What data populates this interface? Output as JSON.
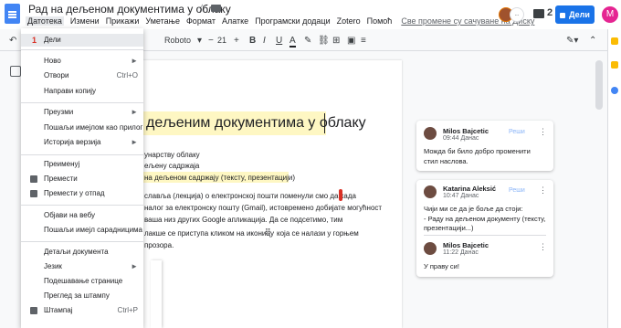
{
  "doc": {
    "title": "Рад на дељеном документима у облаку",
    "save_status": "Све промене су сачуване на Диску",
    "share_label": "Дели",
    "profile_initial": "M",
    "comment_count": "2",
    "extra_avatar_text": "..."
  },
  "menubar": [
    "Датотека",
    "Измени",
    "Прикажи",
    "Уметање",
    "Формат",
    "Алатке",
    "Програмски додаци",
    "Zotero",
    "Помоћ"
  ],
  "toolbar": {
    "font": "Roboto",
    "size": "21",
    "bold": "B",
    "italic": "I",
    "underline": "U",
    "text_color": "A"
  },
  "document": {
    "heading": "дељеним документима у облаку",
    "lines": [
      "унарству облаку",
      "ељену садржаја",
      "на дељеном садржају (тексту, презентацији)",
      "славља (лекција) о електронској пошти поменули смо да када",
      "налог за електронску пошту (Gmail), истовремено добијате могућност",
      "ваша низ других Google апликација.  Да се подсетимо, тим",
      "лакше се приступа кликом на иконицу",
      "која се налази у горњем",
      "прозора."
    ]
  },
  "file_menu": {
    "step_number": "1",
    "items": [
      {
        "label": "Дели",
        "shortcut": ""
      },
      {
        "label": "Ново",
        "shortcut": "►"
      },
      {
        "label": "Отвори",
        "shortcut": "Ctrl+O"
      },
      {
        "label": "Направи копију",
        "shortcut": ""
      },
      {
        "label": "Преузми",
        "shortcut": "►"
      },
      {
        "label": "Пошаљи имејлом као прилог",
        "shortcut": ""
      },
      {
        "label": "Историја верзија",
        "shortcut": "►"
      },
      {
        "label": "Преименуј",
        "shortcut": ""
      },
      {
        "label": "Премести",
        "shortcut": ""
      },
      {
        "label": "Премести у отпад",
        "shortcut": ""
      },
      {
        "label": "Објави на вебу",
        "shortcut": ""
      },
      {
        "label": "Пошаљи имејл сарадницима",
        "shortcut": ""
      },
      {
        "label": "Детаљи документа",
        "shortcut": ""
      },
      {
        "label": "Језик",
        "shortcut": "►"
      },
      {
        "label": "Подешавање странице",
        "shortcut": ""
      },
      {
        "label": "Преглед за штампу",
        "shortcut": ""
      },
      {
        "label": "Штампај",
        "shortcut": "Ctrl+P"
      }
    ]
  },
  "comments": [
    {
      "author": "Milos Bajcetic",
      "date": "09:44 Данас",
      "text": [
        "Можда би било добро променити",
        "стил наслова."
      ],
      "resolve": "Реши"
    },
    {
      "author": "Katarina Aleksić",
      "date": "10:47 Данас",
      "text": [
        "Чији ми се да је боље да стоји:",
        "- Раду на дељеном документу (тексту,",
        "презентацији...)"
      ],
      "resolve": "Реши",
      "reply": {
        "author": "Milos Bajcetic",
        "date": "11:22 Данас",
        "text": "У праву си!"
      }
    }
  ],
  "colors": {
    "accent": "#1a73e8",
    "highlight": "#fef7c3",
    "profile": "#e52592"
  }
}
